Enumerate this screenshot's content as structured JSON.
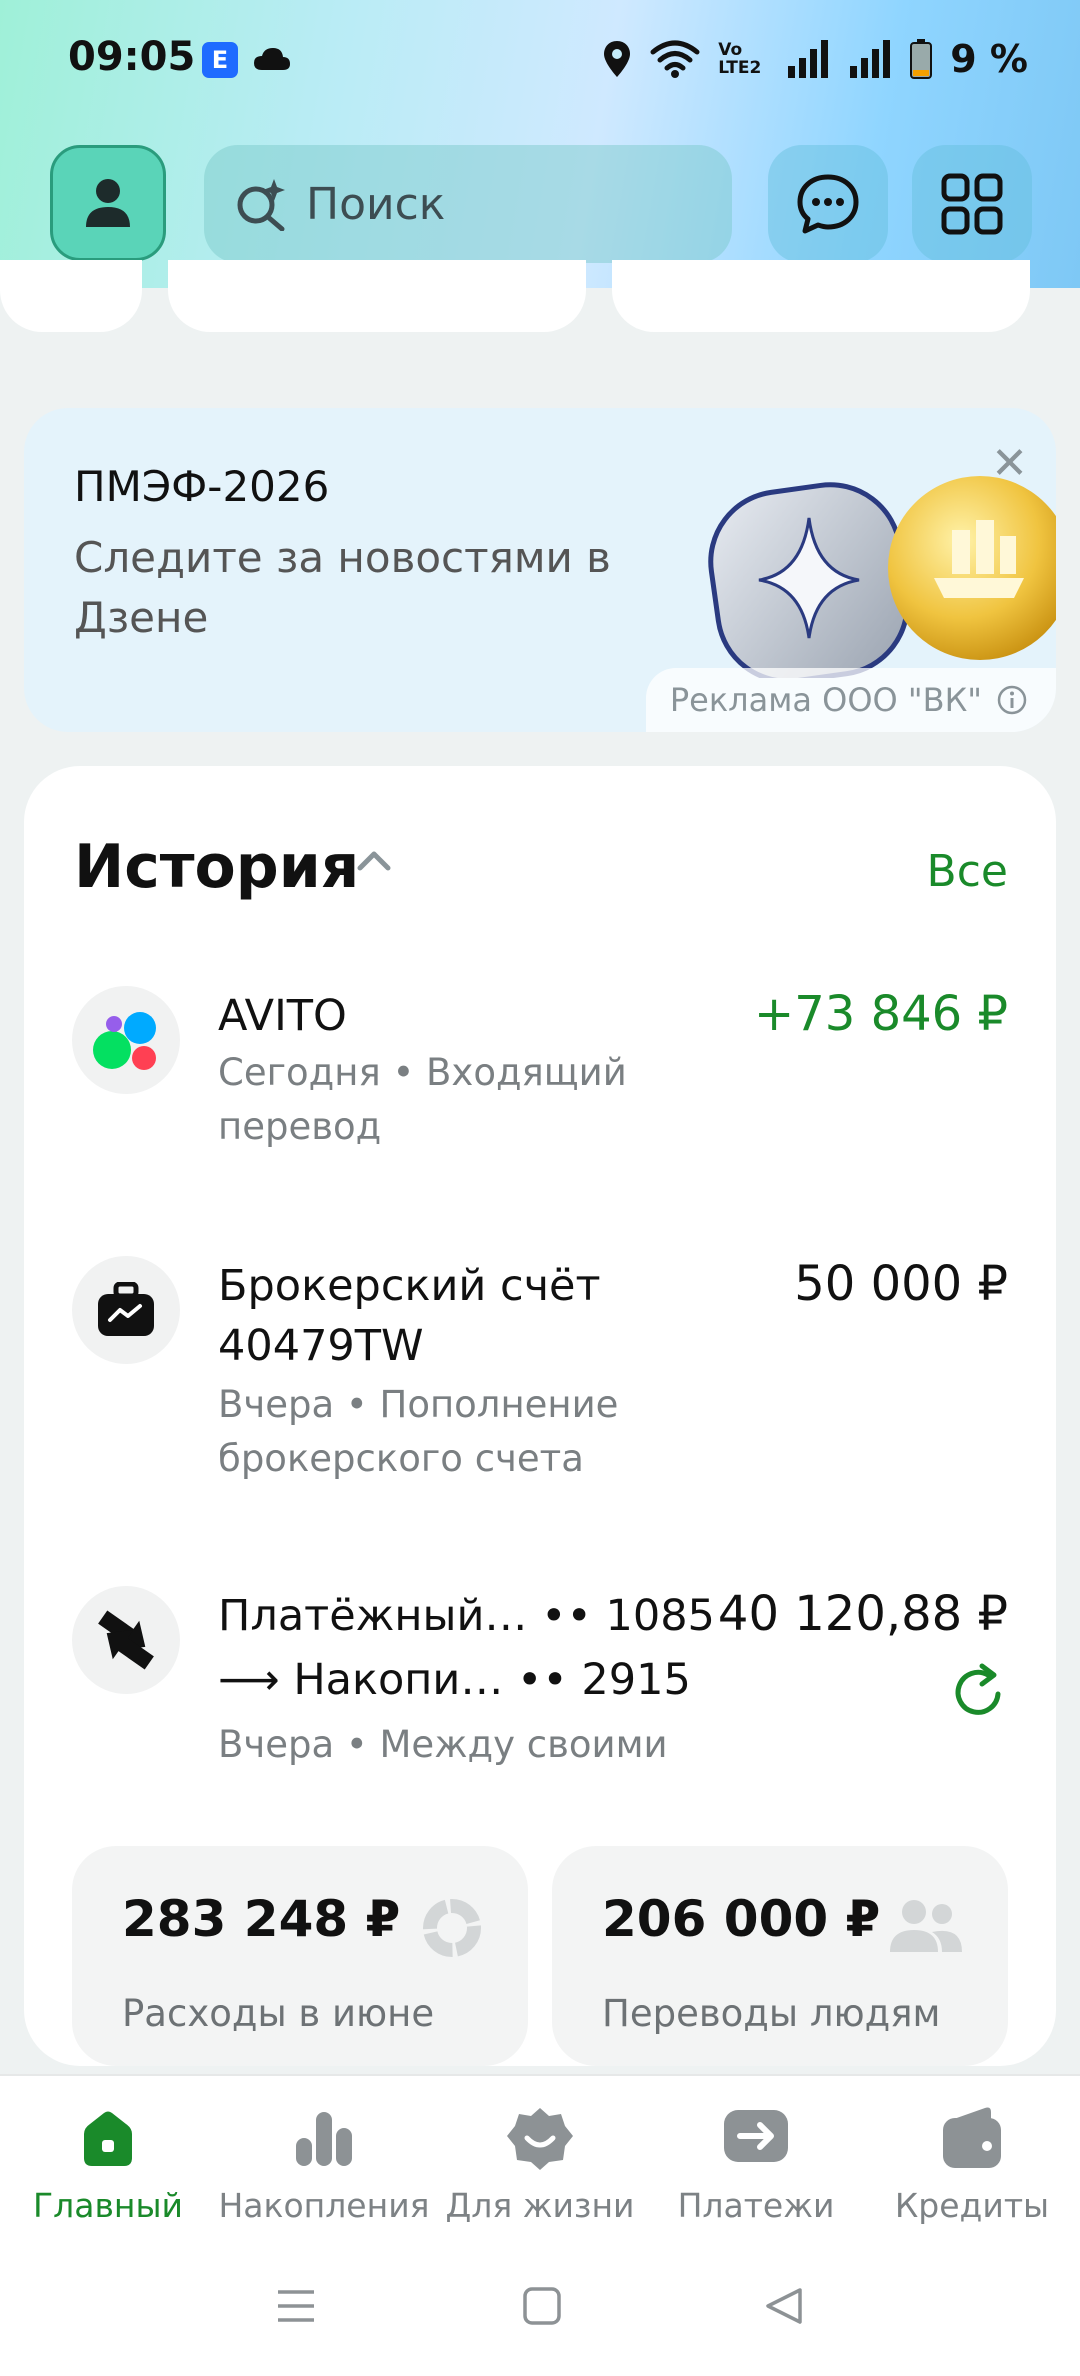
{
  "status_bar": {
    "time": "09:05",
    "app_badge": "E",
    "network_label": "Vo LTE2",
    "battery": "9 %"
  },
  "header": {
    "search_placeholder": "Поиск",
    "icons": [
      "profile-icon",
      "search-sparkle-icon",
      "chat-icon",
      "apps-grid-icon"
    ]
  },
  "ad": {
    "title": "ПМЭФ-2026",
    "subtitle": "Следите за новостями в Дзене",
    "label": "Реклама ООО \"ВК\""
  },
  "history": {
    "title": "История",
    "all_link": "Все",
    "transactions": [
      {
        "name": "AVITO",
        "meta": "Сегодня • Входящий перевод",
        "amount": "+73 846 ₽",
        "amount_color": "#1a8a2a",
        "icon": "avito-icon"
      },
      {
        "name": "Брокерский счёт 40479TW",
        "meta": "Вчера • Пополнение брокерского счета",
        "amount": "50 000 ₽",
        "icon": "briefcase-icon"
      },
      {
        "name_line1": "Платёжный… •• 1085",
        "name_line2": "⟶ Накопи… •• 2915",
        "meta": "Вчера • Между своими",
        "amount": "40 120,88 ₽",
        "icon": "transfer-icon",
        "action_icon": "repeat-icon"
      }
    ]
  },
  "summary": [
    {
      "value": "283 248 ₽",
      "label": "Расходы в июне",
      "icon": "donut-chart-icon"
    },
    {
      "value": "206 000 ₽",
      "label": "Переводы людям",
      "icon": "people-icon"
    }
  ],
  "bottom_nav": {
    "active_color": "#1a8a2a",
    "items": [
      {
        "label": "Главный",
        "icon": "home-icon",
        "active": true
      },
      {
        "label": "Накопления",
        "icon": "bar-chart-icon",
        "active": false
      },
      {
        "label": "Для жизни",
        "icon": "smile-badge-icon",
        "active": false
      },
      {
        "label": "Платежи",
        "icon": "payment-arrow-icon",
        "active": false
      },
      {
        "label": "Кредиты",
        "icon": "wallet-icon",
        "active": false
      }
    ]
  }
}
